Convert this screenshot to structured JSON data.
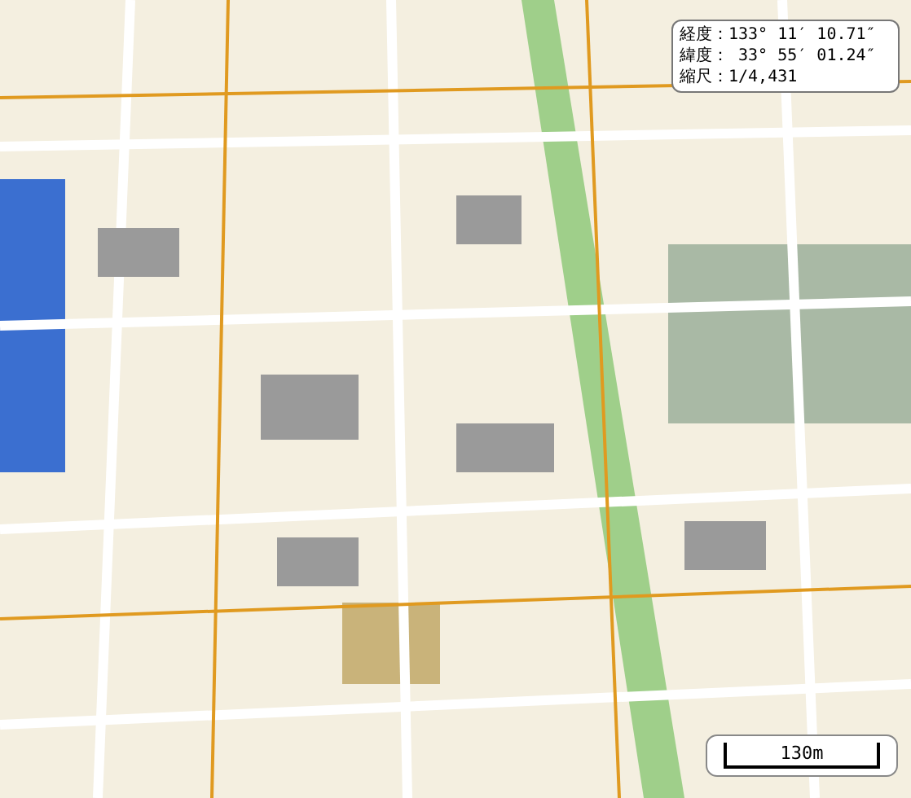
{
  "map": {
    "info_lines": [
      "経度：133° 11′ 10.71″",
      "緯度： 33° 55′ 01.24″",
      "縮尺：1/4,431"
    ],
    "scale_bar": {
      "label": "130m"
    }
  }
}
